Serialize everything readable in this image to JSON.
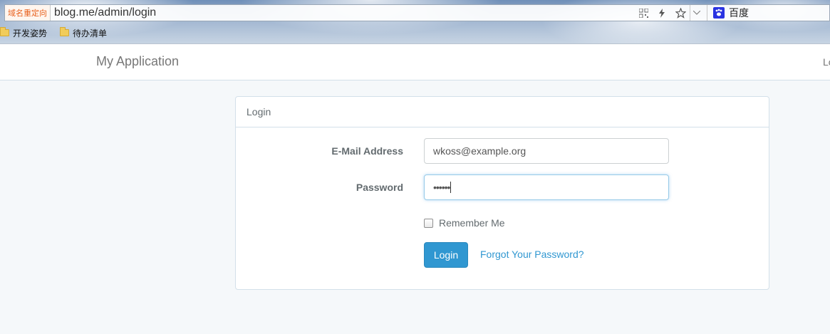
{
  "browser": {
    "redirect_badge": "域名重定向",
    "url": "blog.me/admin/login",
    "search_engine": "百度",
    "bookmarks": [
      {
        "label": "开发姿势"
      },
      {
        "label": "待办清单"
      }
    ]
  },
  "navbar": {
    "brand": "My Application",
    "right_link": "Login"
  },
  "panel": {
    "heading": "Login",
    "email_label": "E-Mail Address",
    "email_value": "wkoss@example.org",
    "password_label": "Password",
    "password_value": "••••••",
    "remember_label": "Remember Me",
    "remember_checked": false,
    "login_button": "Login",
    "forgot_link": "Forgot Your Password?"
  },
  "colors": {
    "primary": "#3097d1",
    "page_bg": "#f5f8fa",
    "border": "#d3e0e9"
  }
}
